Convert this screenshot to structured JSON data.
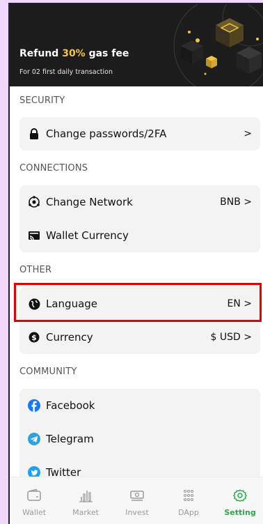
{
  "banner": {
    "title_prefix": "Refund ",
    "title_highlight": "30%",
    "title_suffix": " gas fee",
    "subtitle": "For 02 first daily transaction"
  },
  "sections": {
    "security": "SECURITY",
    "connections": "CONNECTIONS",
    "other": "OTHER",
    "community": "COMMUNITY"
  },
  "security": {
    "change_passwords": {
      "label": "Change passwords/2FA",
      "value": ">",
      "icon": "lock-icon"
    }
  },
  "connections": {
    "change_network": {
      "label": "Change Network",
      "value": "BNB >",
      "icon": "network-icon"
    },
    "wallet_currency": {
      "label": "Wallet Currency",
      "icon": "cast-icon"
    }
  },
  "other": {
    "language": {
      "label": "Language",
      "value": "EN >",
      "icon": "globe-icon"
    },
    "currency": {
      "label": "Currency",
      "value": "$ USD >",
      "icon": "dollar-coin-icon"
    }
  },
  "community": {
    "facebook": {
      "label": "Facebook",
      "icon": "facebook-icon",
      "color": "#1877f2"
    },
    "telegram": {
      "label": "Telegram",
      "icon": "telegram-icon",
      "color": "#2aa3e0"
    },
    "twitter": {
      "label": "Twitter",
      "icon": "twitter-icon",
      "color": "#1da1f2"
    }
  },
  "tabs": [
    {
      "label": "Wallet",
      "icon": "wallet-icon"
    },
    {
      "label": "Market",
      "icon": "market-icon"
    },
    {
      "label": "Invest",
      "icon": "invest-icon"
    },
    {
      "label": "DApp",
      "icon": "dapp-icon"
    },
    {
      "label": "Setting",
      "icon": "gear-icon",
      "active": true
    }
  ],
  "colors": {
    "accent": "#2aa84a",
    "highlight_border": "#e50000",
    "gold": "#f6c443"
  }
}
